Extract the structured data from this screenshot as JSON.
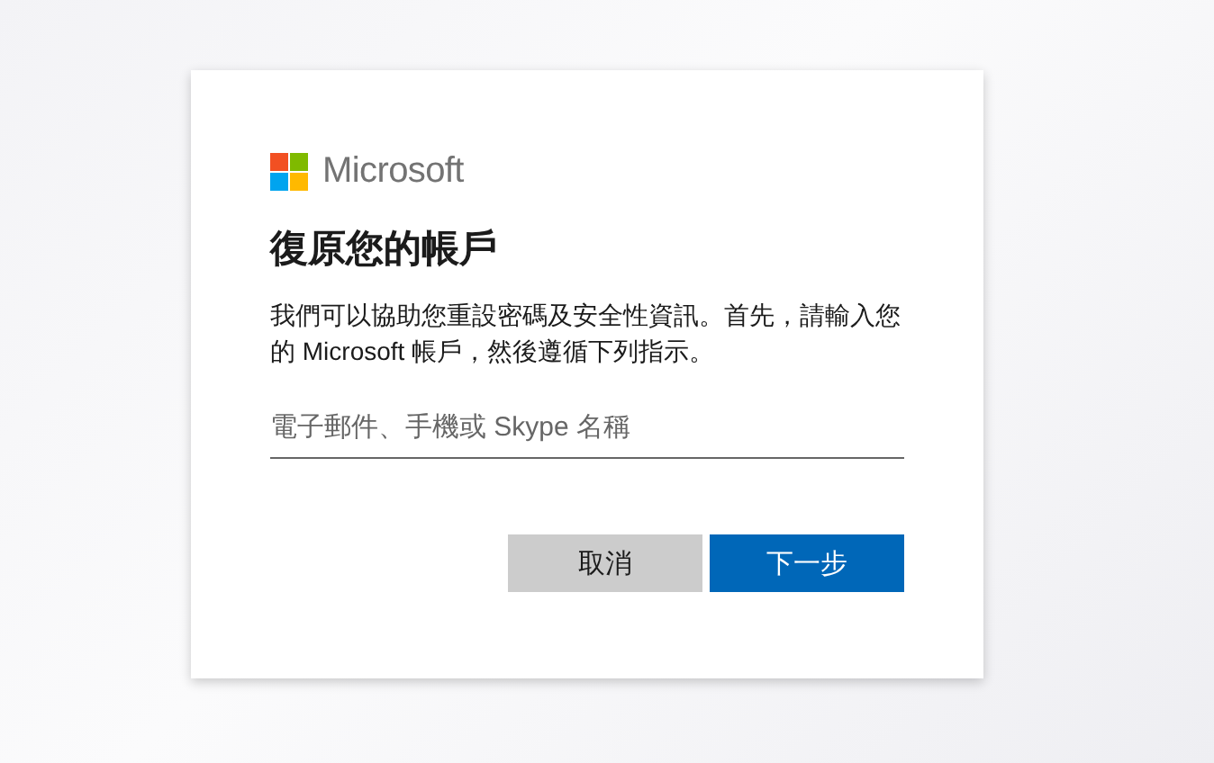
{
  "logo": {
    "text": "Microsoft"
  },
  "title": "復原您的帳戶",
  "description": "我們可以協助您重設密碼及安全性資訊。首先，請輸入您的 Microsoft 帳戶，然後遵循下列指示。",
  "account_field": {
    "placeholder": "電子郵件、手機或 Skype 名稱"
  },
  "buttons": [
    {
      "label": "取消",
      "kind": "secondary"
    },
    {
      "label": "下一步",
      "kind": "primary"
    }
  ]
}
